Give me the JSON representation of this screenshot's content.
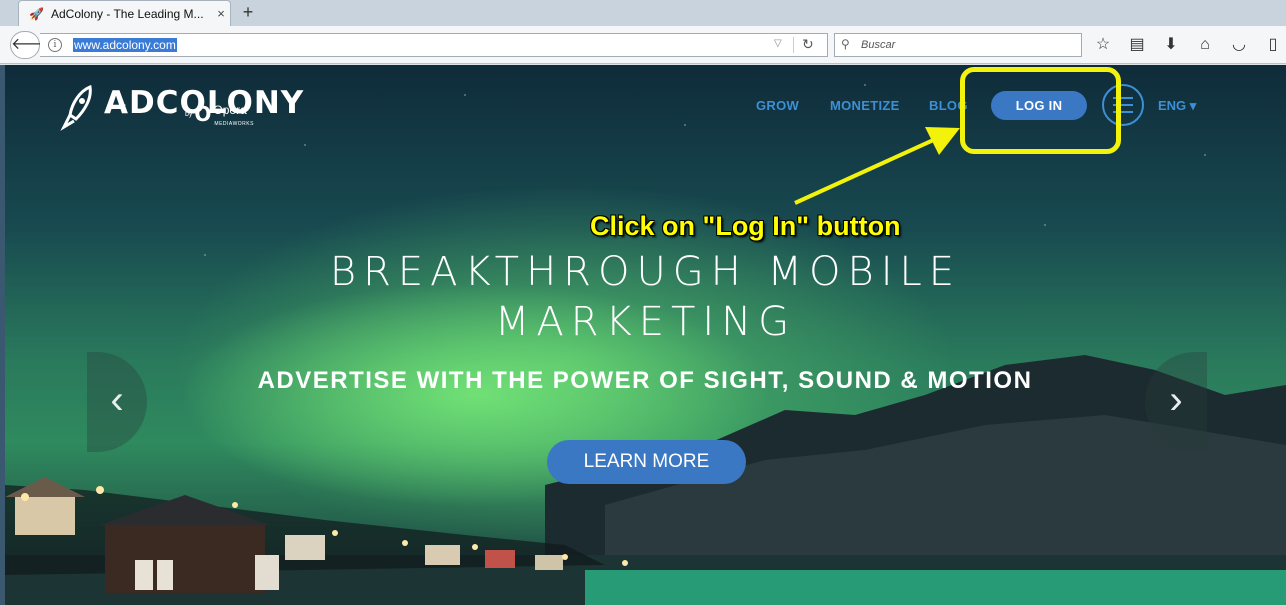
{
  "browser": {
    "tab_title": "AdColony - The Leading M...",
    "tab_close": "×",
    "new_tab": "+",
    "url": "www.adcolony.com",
    "search_placeholder": "Buscar"
  },
  "site": {
    "logo_text": "ADCOLONY",
    "logo_by": "by",
    "opera_o": "O",
    "opera_word": "Opera",
    "opera_sub": "MEDIAWORKS",
    "nav": {
      "grow": "GROW",
      "monetize": "MONETIZE",
      "blog": "BLOG",
      "login": "LOG IN",
      "lang": "ENG ▾"
    },
    "hero": {
      "title_line1": "BREAKTHROUGH MOBILE",
      "title_line2": "MARKETING",
      "subtitle": "ADVERTISE WITH THE POWER OF SIGHT, SOUND & MOTION",
      "cta": "LEARN MORE",
      "prev": "‹",
      "next": "›"
    }
  },
  "annotation": {
    "callout": "Click on \"Log In\" button",
    "color": "#f2f20a"
  },
  "colors": {
    "accent": "#3a78c4",
    "nav_link": "#3d8fd6"
  }
}
